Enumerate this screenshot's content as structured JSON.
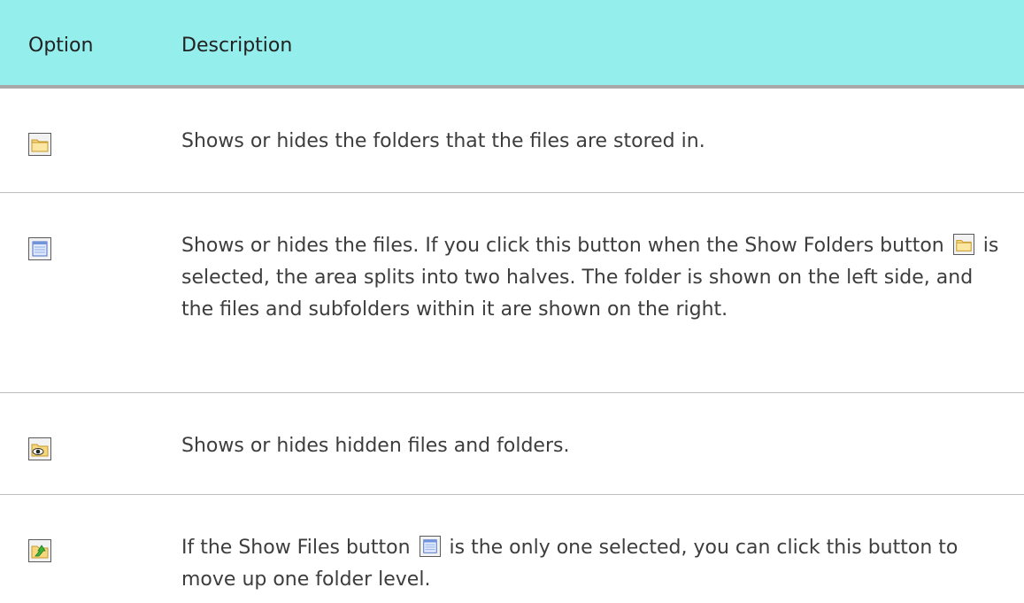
{
  "table": {
    "headers": {
      "option": "Option",
      "description": "Description"
    },
    "rows": [
      {
        "icon": "show-folders-icon",
        "description": "Shows or hides the folders that the files are stored in."
      },
      {
        "icon": "show-files-icon",
        "description_parts": [
          "Shows or hides the files. If you click this button when the Show Folders button",
          "is selected, the area splits into two halves. The folder is shown on the left side, and the files and subfolders within it are shown on the right."
        ],
        "inline_icon": "show-folders-icon"
      },
      {
        "icon": "show-hidden-files-icon",
        "description": "Shows or hides hidden files and folders."
      },
      {
        "icon": "up-one-level-icon",
        "description_parts": [
          "If the Show Files button",
          "is the only one selected, you can click this button to move up one folder level."
        ],
        "inline_icon": "show-files-icon"
      }
    ]
  },
  "colors": {
    "header_bg": "#94eeec",
    "header_border": "#a8a8a8",
    "row_divider": "#bdbdbd",
    "text": "#3d3d3d"
  }
}
